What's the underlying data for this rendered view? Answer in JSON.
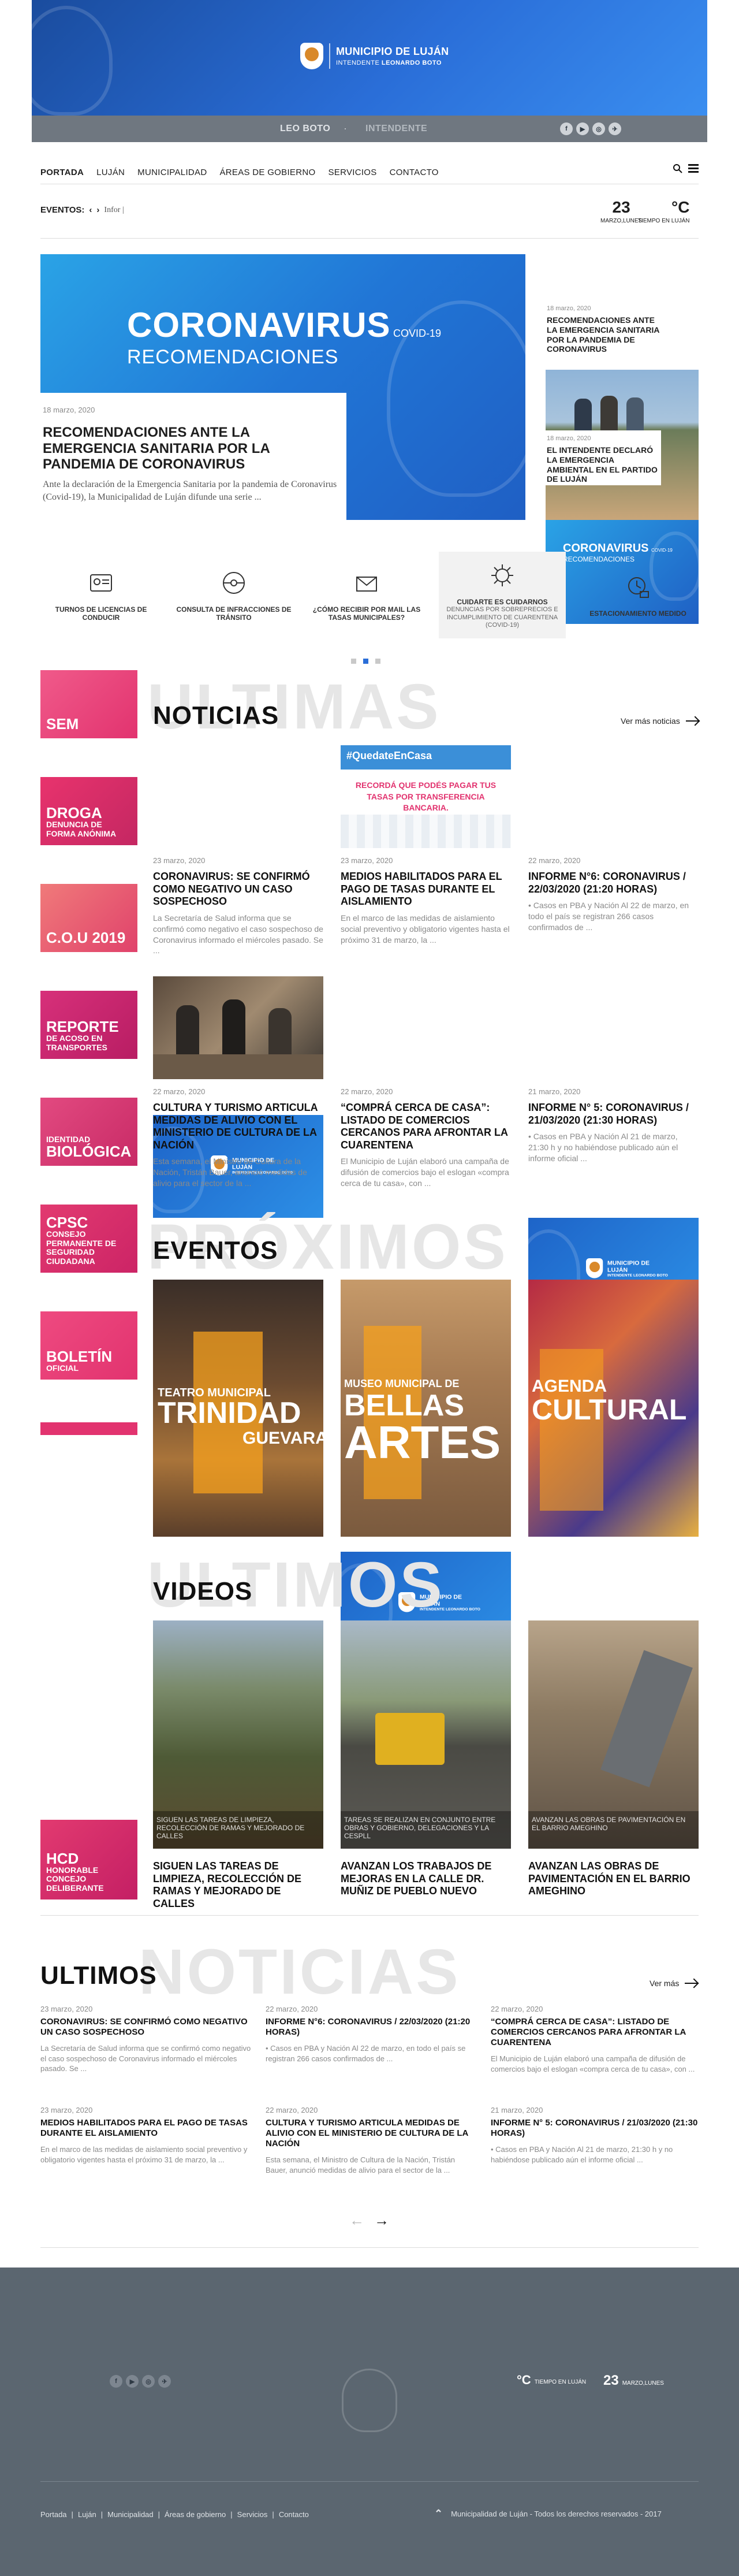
{
  "header": {
    "municipality": "MUNICIPIO DE LUJÁN",
    "intendant_prefix": "INTENDENTE",
    "intendant_name": "LEONARDO BOTO"
  },
  "topbar": {
    "left_name": "LEO BOTO",
    "separator": "·",
    "right_role": "INTENDENTE",
    "social": [
      "f",
      "▶",
      "◎",
      "✈"
    ]
  },
  "nav": {
    "items": [
      "PORTADA",
      "LUJÁN",
      "MUNICIPALIDAD",
      "ÁREAS DE GOBIERNO",
      "SERVICIOS",
      "CONTACTO"
    ]
  },
  "events_bar": {
    "label": "EVENTOS:",
    "text": "Infor |",
    "day": "23",
    "date_label": "MARZO,LUNES",
    "temp": "°C",
    "weather_label": "TIEMPO EN LUJÁN"
  },
  "hero": {
    "banner_big": "CORONAVIRUS",
    "banner_covid": "COVID-19",
    "banner_sub": "RECOMENDACIONES",
    "date": "18 marzo, 2020",
    "title": "RECOMENDACIONES ANTE LA EMERGENCIA SANITARIA POR LA PANDEMIA DE CORONAVIRUS",
    "excerpt": "Ante la declaración de la Emergencia Sanitaria por la pandemia de Coronavirus (Covid-19), la Municipalidad de Luján difunde una serie ..."
  },
  "hero_side": [
    {
      "img_big": "CORONAVIRUS",
      "img_covid": "COVID-19",
      "img_sub": "RECOMENDACIONES",
      "date": "18 marzo, 2020",
      "title": "RECOMENDACIONES ANTE LA EMERGENCIA SANITARIA POR LA PANDEMIA DE CORONAVIRUS"
    },
    {
      "date": "18 marzo, 2020",
      "title": "EL INTENDENTE DECLARÓ LA EMERGENCIA AMBIENTAL EN EL PARTIDO DE LUJÁN"
    }
  ],
  "quick_access": [
    {
      "label": "TURNOS DE LICENCIAS DE CONDUCIR",
      "sub": ""
    },
    {
      "label": "CONSULTA DE INFRACCIONES DE TRÁNSITO",
      "sub": ""
    },
    {
      "label": "¿CÓMO RECIBIR POR MAIL LAS TASAS MUNICIPALES?",
      "sub": ""
    },
    {
      "label": "CUIDARTE ES CUIDARNOS",
      "sub": "DENUNCIAS POR SOBREPRECIOS E INCUMPLIMIENTO DE CUARENTENA (COVID-19)"
    },
    {
      "label": "ESTACIONAMIENTO MEDIDO",
      "sub": ""
    }
  ],
  "sidebar_tags": [
    {
      "line1": "",
      "line2": "SEM",
      "color": "#e8336d"
    },
    {
      "line1": "DROGA",
      "line2": "DENUNCIA DE FORMA ANÓNIMA",
      "color": "#d42b63"
    },
    {
      "line1": "",
      "line2": "C.O.U 2019",
      "color": "#e04a6b"
    },
    {
      "line1": "REPORTE",
      "line2": "DE ACOSO EN TRANSPORTES",
      "color": "#c9246e"
    },
    {
      "line1": "IDENTIDAD",
      "line2": "BIOLÓGICA",
      "color": "#d0306a"
    },
    {
      "line1": "CPSC",
      "line2": "CONSEJO PERMANENTE DE SEGURIDAD CIUDADANA",
      "color": "#d7276a"
    },
    {
      "line1": "BOLETÍN",
      "line2": "OFICIAL",
      "color": "#e2336f"
    },
    {
      "line1": "HCD",
      "line2": "HONORABLE CONCEJO DELIBERANTE",
      "color": "#c41f64"
    }
  ],
  "news": {
    "ghost": "ULTIMAS",
    "title": "NOTICIAS",
    "more": "Ver más noticias",
    "img_label": "MUNICIPIO DE LUJÁN",
    "img_label_sub": "INTENDENTE LEONARDO BOTO",
    "quedate_tag": "#QuedateEnCasa",
    "quedate_text": "RECORDÁ QUE PODÉS PAGAR TUS TASAS POR TRANSFERENCIA BANCARIA.",
    "items": [
      {
        "date": "23 marzo, 2020",
        "title": "CORONAVIRUS: SE CONFIRMÓ COMO NEGATIVO UN CASO SOSPECHOSO",
        "text": "La Secretaría de Salud informa que se confirmó como negativo el caso sospechoso de Coronavirus informado el miércoles pasado. Se ..."
      },
      {
        "date": "23 marzo, 2020",
        "title": "MEDIOS HABILITADOS PARA EL PAGO DE TASAS DURANTE EL AISLAMIENTO",
        "text": "En el marco de las medidas de aislamiento social preventivo y obligatorio vigentes hasta el próximo 31 de marzo, la ..."
      },
      {
        "date": "22 marzo, 2020",
        "title": "INFORME N°6: CORONAVIRUS / 22/03/2020 (21:20 HORAS)",
        "text": "• Casos en PBA y Nación Al 22 de marzo, en todo el país se registran 266 casos confirmados de ..."
      },
      {
        "date": "22 marzo, 2020",
        "title": "CULTURA Y TURISMO ARTICULA MEDIDAS DE ALIVIO CON EL MINISTERIO DE CULTURA DE LA NACIÓN",
        "text": "Esta semana, el Ministro de Cultura de la Nación, Tristán Bauer, anunció medidas de alivio para el sector de la ..."
      },
      {
        "date": "22 marzo, 2020",
        "title": "“COMPRÁ CERCA DE CASA”: LISTADO DE COMERCIOS CERCANOS PARA AFRONTAR LA CUARENTENA",
        "text": "El Municipio de Luján elaboró una campaña de difusión de comercios bajo el eslogan «compra cerca de tu casa», con ..."
      },
      {
        "date": "21 marzo, 2020",
        "title": "INFORME N° 5: CORONAVIRUS / 21/03/2020 (21:30 HORAS)",
        "text": "• Casos en PBA y Nación Al 21 de marzo, 21:30 h y no habiéndose publicado aún el informe oficial ..."
      }
    ]
  },
  "events": {
    "ghost": "PRÓXIMOS",
    "title": "EVENTOS",
    "cards": [
      {
        "top": "TEATRO MUNICIPAL",
        "big1": "TRINIDAD",
        "big2": "GUEVARA"
      },
      {
        "top": "MUSEO MUNICIPAL DE",
        "big1": "BELLAS",
        "big2": "ARTES"
      },
      {
        "top": "AGENDA",
        "big1": "CULTURAL",
        "big2": ""
      }
    ]
  },
  "videos": {
    "ghost": "ULTIMOS",
    "title": "VIDEOS",
    "items": [
      {
        "overlay": "SIGUEN LAS TAREAS DE LIMPIEZA, RECOLECCIÓN DE RAMAS Y MEJORADO DE CALLES",
        "title": "SIGUEN LAS TAREAS DE LIMPIEZA, RECOLECCIÓN DE RAMAS Y MEJORADO DE CALLES"
      },
      {
        "overlay": "TAREAS SE REALIZAN EN CONJUNTO ENTRE OBRAS Y GOBIERNO, DELEGACIONES Y LA CESPLL",
        "title": "AVANZAN LOS TRABAJOS DE MEJORAS EN LA CALLE DR. MUÑIZ DE PUEBLO NUEVO"
      },
      {
        "overlay": "AVANZAN LAS OBRAS DE PAVIMENTACIÓN EN EL BARRIO AMEGHINO",
        "title": "AVANZAN LAS OBRAS DE PAVIMENTACIÓN EN EL BARRIO AMEGHINO"
      }
    ]
  },
  "latest": {
    "ghost": "NOTICIAS",
    "title": "ULTIMOS",
    "more": "Ver más",
    "items": [
      {
        "date": "23 marzo, 2020",
        "title": "CORONAVIRUS: SE CONFIRMÓ COMO NEGATIVO UN CASO SOSPECHOSO",
        "text": "La Secretaría de Salud informa que se confirmó como negativo el caso sospechoso de Coronavirus informado el miércoles pasado. Se ..."
      },
      {
        "date": "22 marzo, 2020",
        "title": "INFORME N°6: CORONAVIRUS / 22/03/2020 (21:20 HORAS)",
        "text": "• Casos en PBA y Nación Al 22 de marzo, en todo el país se registran 266 casos confirmados de ..."
      },
      {
        "date": "22 marzo, 2020",
        "title": "“COMPRÁ CERCA DE CASA”: LISTADO DE COMERCIOS CERCANOS PARA AFRONTAR LA CUARENTENA",
        "text": "El Municipio de Luján elaboró una campaña de difusión de comercios bajo el eslogan «compra cerca de tu casa», con ..."
      },
      {
        "date": "23 marzo, 2020",
        "title": "MEDIOS HABILITADOS PARA EL PAGO DE TASAS DURANTE EL AISLAMIENTO",
        "text": "En el marco de las medidas de aislamiento social preventivo y obligatorio vigentes hasta el próximo 31 de marzo, la ..."
      },
      {
        "date": "22 marzo, 2020",
        "title": "CULTURA Y TURISMO ARTICULA MEDIDAS DE ALIVIO CON EL MINISTERIO DE CULTURA DE LA NACIÓN",
        "text": "Esta semana, el Ministro de Cultura de la Nación, Tristán Bauer, anunció medidas de alivio para el sector de la ..."
      },
      {
        "date": "21 marzo, 2020",
        "title": "INFORME N° 5: CORONAVIRUS / 21/03/2020 (21:30 HORAS)",
        "text": "• Casos en PBA y Nación Al 21 de marzo, 21:30 h y no habiéndose publicado aún el informe oficial ..."
      }
    ]
  },
  "footer": {
    "temp": "°C",
    "weather_label": "TIEMPO EN LUJÁN",
    "day": "23",
    "date_label": "MARZO,LUNES",
    "links": [
      "Portada",
      "|",
      "Luján",
      "|",
      "Municipalidad",
      "|",
      "Áreas de gobierno",
      "|",
      "Servicios",
      "|",
      "Contacto"
    ],
    "copyright": "Municipalidad de Luján - Todos los derechos reservados - 2017",
    "social": [
      "f",
      "▶",
      "◎",
      "✈"
    ]
  },
  "colors": {
    "blue": "#2a6ed8",
    "pink": "#e2336f",
    "topbar": "#6f7780",
    "footer": "#5b6670"
  }
}
